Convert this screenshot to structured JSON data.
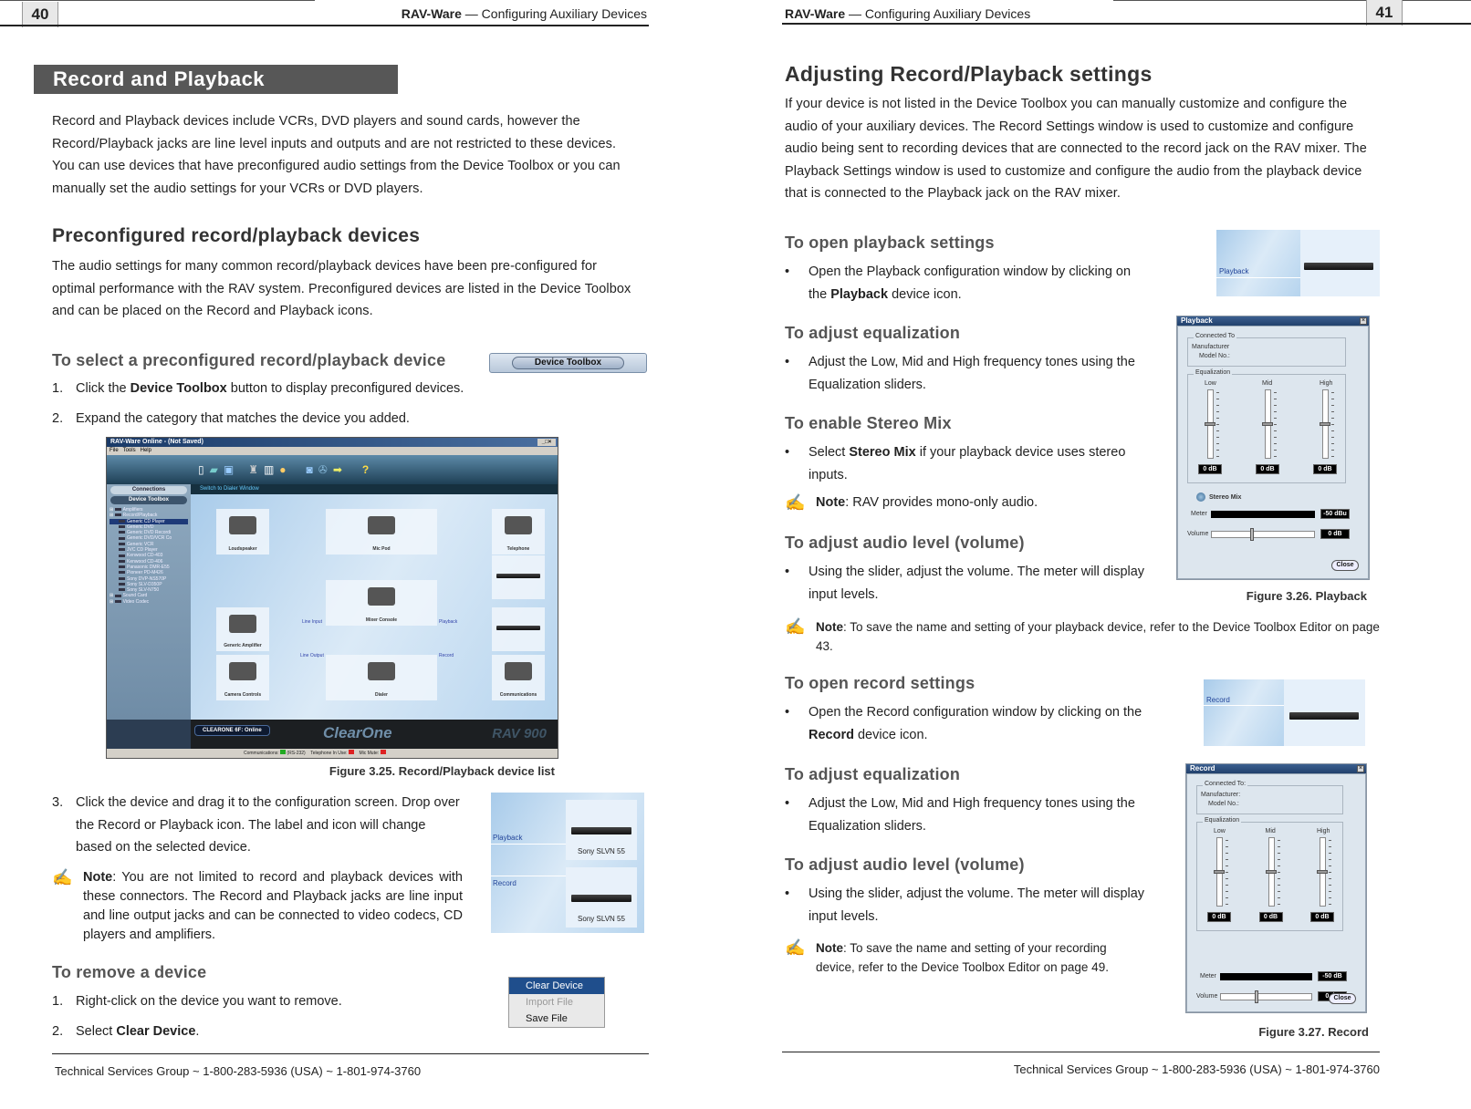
{
  "left_page": {
    "page_number": "40",
    "running_header_bold": "RAV-Ware",
    "running_header_rest": " — Configuring Auxiliary Devices",
    "section_banner": "Record and Playback",
    "intro": "Record and Playback devices include VCRs, DVD players and sound cards, however the Record/Playback jacks are line level inputs and outputs and are not restricted to these devices. You can use devices that have preconfigured audio settings from the Device Toolbox or you can manually set the audio settings for your VCRs or DVD players.",
    "preconfigured_heading": "Preconfigured record/playback devices",
    "preconfigured_text": "The audio settings for many common record/playback devices have been pre-configured for optimal performance with the RAV system. Preconfigured devices are listed in the Device Toolbox and can be placed on the Record and Playback icons.",
    "select_heading": "To select a preconfigured record/playback device",
    "device_toolbox_button": "Device Toolbox",
    "steps": [
      {
        "n": "1.",
        "pre": "Click the ",
        "bold": "Device Toolbox",
        "post": " button to display preconfigured devices."
      },
      {
        "n": "2.",
        "pre": "Expand the category that matches the device you added.",
        "bold": "",
        "post": ""
      }
    ],
    "figure_325_caption": "Figure 3.25. Record/Playback device list",
    "step3_n": "3.",
    "step3_text": "Click the device and drag it to the configuration screen. Drop over the Record or Playback icon. The label and icon will change based on the selected device.",
    "note1_label": "Note",
    "note1_text": ": You are not limited to record and playback devices with these connectors. The Record and Playback jacks are line input and line output jacks and can be connected to video codecs, CD players and amplifiers.",
    "remove_heading": "To remove a device",
    "remove_steps": [
      {
        "n": "1.",
        "pre": "Right-click on the device you want to remove.",
        "bold": ""
      },
      {
        "n": "2.",
        "pre": "Select ",
        "bold": "Clear Device",
        "post": "."
      }
    ],
    "context_menu": [
      "Clear Device",
      "Import File",
      "Save File"
    ],
    "drop_shot": {
      "playback_label": "Playback",
      "record_label": "Record",
      "device1": "Sony SLVN 55",
      "device2": "Sony SLVN 55"
    },
    "footer": "Technical Services Group ~ 1-800-283-5936 (USA) ~ 1-801-974-3760"
  },
  "app_screenshot": {
    "title": "RAV-Ware    Online - (Not Saved)",
    "menu": [
      "File",
      "Tools",
      "Help"
    ],
    "sidebar_buttons": [
      "Connections",
      "Device Toolbox"
    ],
    "tree": [
      {
        "label": "Amplifiers",
        "level": 0,
        "expand": "+"
      },
      {
        "label": "Record/Playback",
        "level": 0,
        "expand": "-"
      },
      {
        "label": "Generic    CD Player",
        "level": 1,
        "selected": true
      },
      {
        "label": "Generic    DVD",
        "level": 1
      },
      {
        "label": "Generic    DVD Recordi",
        "level": 1
      },
      {
        "label": "Generic    DVD/VCR Co",
        "level": 1
      },
      {
        "label": "Generic    VCR",
        "level": 1
      },
      {
        "label": "JVC    CD Player",
        "level": 1
      },
      {
        "label": "Kenwood    CD-403",
        "level": 1
      },
      {
        "label": "Kenwood    CD-406",
        "level": 1
      },
      {
        "label": "Panasonic    DMR-E55",
        "level": 1
      },
      {
        "label": "Pioneer    PD-M426",
        "level": 1
      },
      {
        "label": "Sony    DVP-NS570P",
        "level": 1
      },
      {
        "label": "Sony    SLV-D350P",
        "level": 1
      },
      {
        "label": "Sony    SLV-N750",
        "level": 1
      },
      {
        "label": "Sound Card",
        "level": 0,
        "expand": "+"
      },
      {
        "label": "Video Codec",
        "level": 0,
        "expand": "+"
      }
    ],
    "switch_link": "Switch to Dialer Window",
    "devices": [
      "Loudspeaker",
      "Mic Pod",
      "Telephone",
      "Generic Amplifier",
      "Mixer Console",
      "Camera Controls",
      "Dialer",
      "Communications"
    ],
    "connector_labels": [
      "Line Input",
      "Line Output",
      "Playback",
      "Record"
    ],
    "status_badge": "CLEARONE 6F: Online",
    "brand": "ClearOne",
    "product": "RAV 900",
    "statusbar": [
      "Communications:",
      "(RS-232)",
      "Telephone In Use:",
      "Mic Mute:"
    ]
  },
  "right_page": {
    "page_number": "41",
    "running_header_bold": "RAV-Ware",
    "running_header_rest": " — Configuring Auxiliary Devices",
    "main_heading": "Adjusting Record/Playback settings",
    "intro": "If your device is not listed in the Device Toolbox you can manually customize and configure the audio of your auxiliary devices. The Record Settings window is used to customize and configure audio being sent to recording devices that are connected to the record jack on the RAV mixer. The Playback Settings window is used to customize and configure the audio from the playback device that is connected to the Playback jack on the RAV mixer.",
    "open_playback_heading": "To open playback settings",
    "open_playback_pre": "Open the Playback configuration window by clicking on the ",
    "open_playback_bold": "Playback",
    "open_playback_post": " device icon.",
    "eq_heading_1": "To adjust equalization",
    "eq_text_1": "Adjust the Low, Mid and High frequency tones using the Equalization sliders.",
    "stereo_heading": "To enable Stereo Mix",
    "stereo_pre": "Select ",
    "stereo_bold": "Stereo Mix",
    "stereo_post": " if your playback device uses stereo inputs.",
    "note_mono_label": "Note",
    "note_mono_text": ": RAV provides mono-only audio.",
    "volume_heading_1": "To adjust audio level (volume)",
    "volume_text_1": "Using the slider, adjust the volume. The meter will display input levels.",
    "figure_326_caption": "Figure 3.26. Playback",
    "note_playback_label": "Note",
    "note_playback_text": ": To save the name and setting of your playback device, refer to the Device Toolbox Editor on page 43.",
    "open_record_heading": "To open record settings",
    "open_record_pre": "Open the Record configuration window by clicking on the ",
    "open_record_bold": "Record",
    "open_record_post": " device icon.",
    "eq_heading_2": "To adjust equalization",
    "eq_text_2": "Adjust the Low, Mid and High frequency tones using the Equalization sliders.",
    "volume_heading_2": "To adjust audio level (volume)",
    "volume_text_2": "Using the slider, adjust the volume. The meter will display input levels.",
    "note_record_label": "Note",
    "note_record_text": ": To save the name and setting of your recording device, refer to the Device Toolbox Editor on page 49.",
    "figure_327_caption": "Figure 3.27. Record",
    "playback_icon_label": "Playback",
    "record_icon_label": "Record",
    "footer": "Technical Services Group ~ 1-800-283-5936 (USA) ~ 1-801-974-3760"
  },
  "playback_dialog": {
    "title": "Playback",
    "connected_to": "Connected To",
    "manufacturer": "Manufacturer",
    "model_no": "Model No.:",
    "equalization": "Equalization",
    "bands": [
      {
        "label": "Low",
        "value": "0 dB",
        "level": 0.5
      },
      {
        "label": "Mid",
        "value": "0 dB",
        "level": 0.5
      },
      {
        "label": "High",
        "value": "0 dB",
        "level": 0.5
      }
    ],
    "stereo_mix": "Stereo Mix",
    "meter_label": "Meter",
    "meter_value": "-50 dBu",
    "volume_label": "Volume",
    "volume_value": "0 dB",
    "volume_level": 0.5,
    "close": "Close"
  },
  "record_dialog": {
    "title": "Record",
    "connected_to": "Connected To:",
    "manufacturer": "Manufacturer:",
    "model_no": "Model No.:",
    "equalization": "Equalization",
    "bands": [
      {
        "label": "Low",
        "value": "0 dB",
        "level": 0.5
      },
      {
        "label": "Mid",
        "value": "0 dB",
        "level": 0.5
      },
      {
        "label": "High",
        "value": "0 dB",
        "level": 0.5
      }
    ],
    "meter_label": "Meter",
    "meter_value": "-50 dB",
    "volume_label": "Volume",
    "volume_value": "0 dB",
    "volume_level": 0.5,
    "close": "Close"
  }
}
